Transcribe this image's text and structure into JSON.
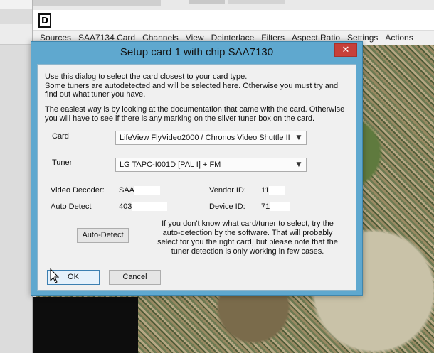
{
  "app": {
    "icon_letter": "D",
    "menu": [
      "Sources",
      "SAA7134 Card",
      "Channels",
      "View",
      "Deinterlace",
      "Filters",
      "Aspect Ratio",
      "Settings",
      "Actions"
    ]
  },
  "dialog": {
    "title": "Setup card 1 with chip SAA7130",
    "close_glyph": "✕",
    "intro": "Use this dialog to select the card closest to your card type.\nSome tuners are autodetected and will be selected here.  Otherwise you must try and\nfind out what tuner you have.",
    "intro2": "The easiest way is by looking at the documentation that came with the card. Otherwise\nyou will have to see if there is any marking on the silver tuner box on the card.",
    "card_label": "Card",
    "card_value": "LifeView FlyVideo2000 / Chronos Video Shuttle II",
    "tuner_label": "Tuner",
    "tuner_value": "LG TAPC-I001D [PAL I] + FM",
    "video_decoder_label": "Video Decoder:",
    "video_decoder_value": "SAA",
    "auto_detect_label": "Auto Detect",
    "auto_detect_value": "403",
    "vendor_id_label": "Vendor ID:",
    "vendor_id_value": "11",
    "device_id_label": "Device ID:",
    "device_id_value": "71",
    "auto_detect_button": "Auto-Detect",
    "help_text": "If you don't know what card/tuner to select, try the\nauto-detection by the software. That will probably\nselect for you the right card, but please note that the\ntuner detection is only working in few cases.",
    "ok_button": "OK",
    "cancel_button": "Cancel",
    "dropdown_arrow": "▼"
  },
  "colors": {
    "dialog_frame": "#5fa8cf",
    "close_button": "#c7403a"
  }
}
